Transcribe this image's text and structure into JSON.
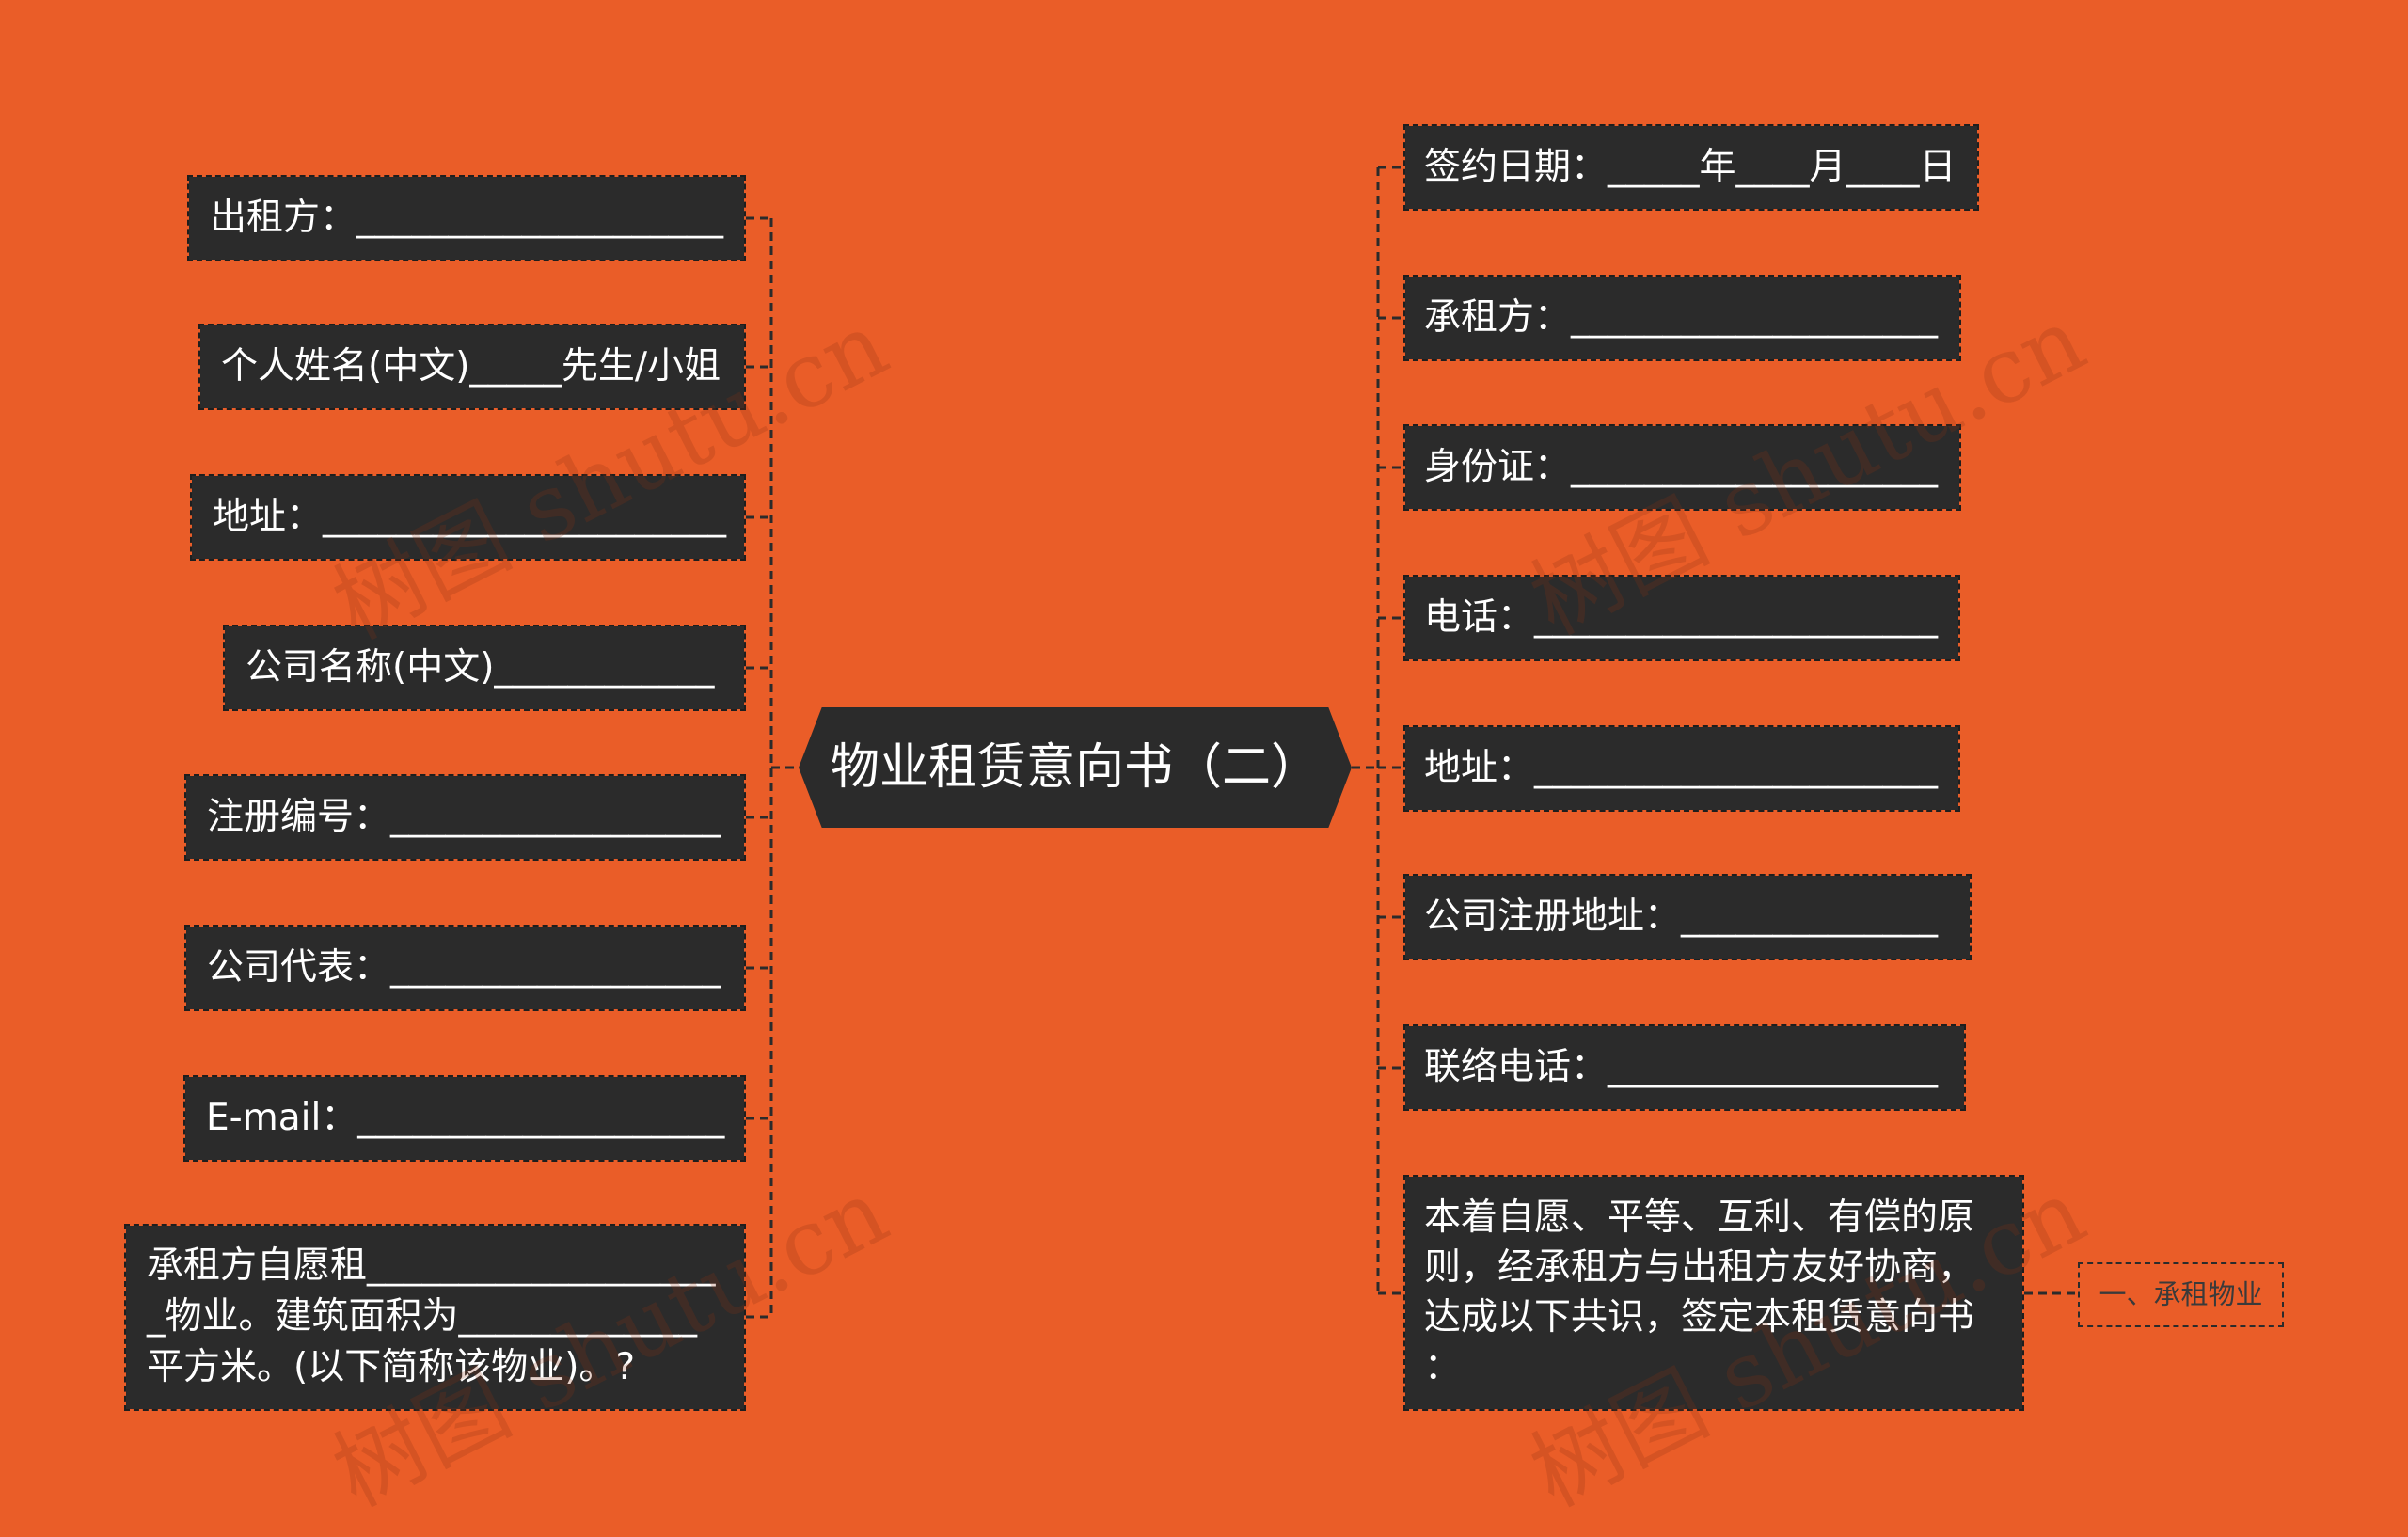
{
  "colors": {
    "background": "#EA5D28",
    "topic_fill": "#2B2B2B",
    "topic_text": "#FFFFFF",
    "connector": "#2B2B2B",
    "subtopic_text": "#3A3A3A"
  },
  "mindmap": {
    "root": "物业租赁意向书（二）",
    "left": [
      "出租方：____________________",
      "个人姓名(中文)_____先生/小姐",
      "地址：______________________",
      "公司名称(中文)____________",
      "注册编号：__________________",
      "公司代表：__________________",
      "E-mail：____________________"
    ],
    "left_note": [
      "承租方自愿租___________________",
      "_物业。建筑面积为_____________",
      "平方米。(以下简称该物业)。?"
    ],
    "right": [
      "签约日期：_____年____月____日",
      "承租方：____________________",
      "身份证：____________________",
      "电话：______________________",
      "地址：______________________",
      "公司注册地址：______________",
      "联络电话：__________________"
    ],
    "right_note": [
      "本着自愿、平等、互利、有偿的原",
      "则，经承租方与出租方友好协商，",
      "达成以下共识，签定本租赁意向书",
      "："
    ],
    "right_note_child": "一、承租物业"
  },
  "watermark": "树图 shutu.cn"
}
